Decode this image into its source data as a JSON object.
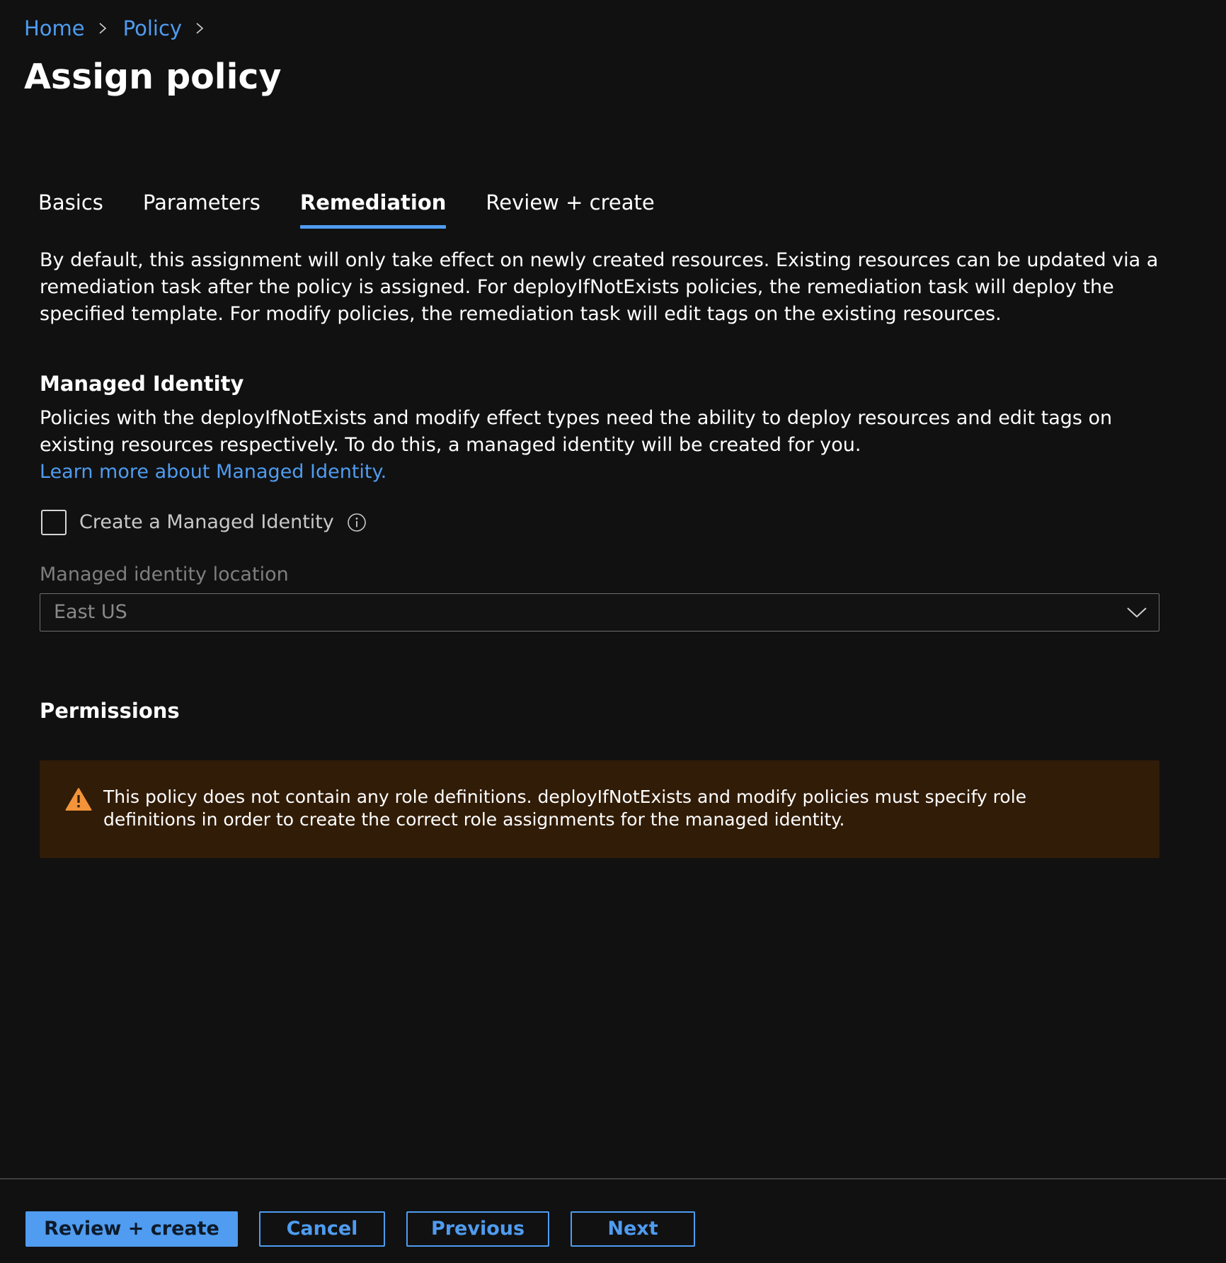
{
  "breadcrumb": {
    "items": [
      "Home",
      "Policy"
    ]
  },
  "page": {
    "title": "Assign policy"
  },
  "tabs": [
    {
      "label": "Basics",
      "active": false
    },
    {
      "label": "Parameters",
      "active": false
    },
    {
      "label": "Remediation",
      "active": true
    },
    {
      "label": "Review + create",
      "active": false
    }
  ],
  "remediation": {
    "intro": "By default, this assignment will only take effect on newly created resources. Existing resources can be updated via a remediation task after the policy is assigned. For deployIfNotExists policies, the remediation task will deploy the specified template. For modify policies, the remediation task will edit tags on the existing resources."
  },
  "managed_identity": {
    "heading": "Managed Identity",
    "description": "Policies with the deployIfNotExists and modify effect types need the ability to deploy resources and edit tags on existing resources respectively. To do this, a managed identity will be created for you.",
    "learn_more": "Learn more about Managed Identity.",
    "checkbox_label": "Create a Managed Identity",
    "checkbox_checked": false,
    "location_label": "Managed identity location",
    "location_value": "East US"
  },
  "permissions": {
    "heading": "Permissions",
    "warning": "This policy does not contain any role definitions. deployIfNotExists and modify policies must specify role definitions in order to create the correct role assignments for the managed identity."
  },
  "footer": {
    "review_create": "Review + create",
    "cancel": "Cancel",
    "previous": "Previous",
    "next": "Next"
  },
  "colors": {
    "background": "#111112",
    "accent": "#4f9cf0",
    "warning_bg": "#311c07",
    "warning_icon": "#f3943a"
  },
  "icons": {
    "breadcrumb_separator": "chevron-right-icon",
    "info": "info-icon",
    "dropdown": "chevron-down-icon",
    "warning": "warning-icon"
  }
}
